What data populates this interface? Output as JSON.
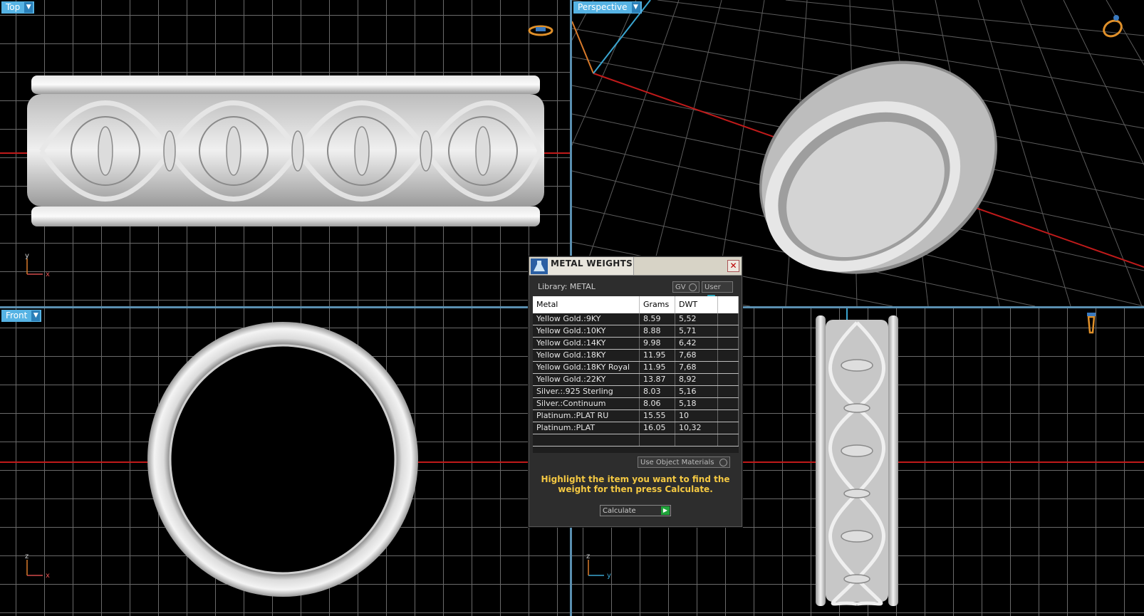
{
  "viewports": {
    "top": {
      "label": "Top",
      "axes": {
        "a": "y",
        "b": "x"
      }
    },
    "perspective": {
      "label": "Perspective"
    },
    "front": {
      "label": "Front",
      "axes": {
        "a": "z",
        "b": "x"
      }
    },
    "right": {
      "axes": {
        "a": "z",
        "b": "y"
      }
    }
  },
  "dialog": {
    "title": "METAL WEIGHTS",
    "close": "✕",
    "library": "Library: METAL",
    "gv_label": "GV",
    "user_label": "User",
    "columns": [
      "Metal",
      "Grams",
      "DWT"
    ],
    "rows": [
      {
        "metal": "Yellow Gold.:9KY",
        "grams": "8.59",
        "dwt": "5,52"
      },
      {
        "metal": "Yellow Gold.:10KY",
        "grams": "8.88",
        "dwt": "5,71"
      },
      {
        "metal": "Yellow Gold.:14KY",
        "grams": "9.98",
        "dwt": "6,42"
      },
      {
        "metal": "Yellow Gold.:18KY",
        "grams": "11.95",
        "dwt": "7,68"
      },
      {
        "metal": "Yellow Gold.:18KY Royal",
        "grams": "11.95",
        "dwt": "7,68"
      },
      {
        "metal": "Yellow Gold.:22KY",
        "grams": "13.87",
        "dwt": "8,92"
      },
      {
        "metal": "Silver.:.925 Sterling",
        "grams": "8.03",
        "dwt": "5,16"
      },
      {
        "metal": "Silver.:Continuum",
        "grams": "8.06",
        "dwt": "5,18"
      },
      {
        "metal": "Platinum.:PLAT RU",
        "grams": "15.55",
        "dwt": "10"
      },
      {
        "metal": "Platinum.:PLAT",
        "grams": "16.05",
        "dwt": "10,32"
      }
    ],
    "use_object_materials": "Use Object Materials",
    "hint": "Highlight the item you want to find the weight for then press Calculate.",
    "calculate": "Calculate"
  },
  "colors": {
    "accent": "#56b3e4",
    "axis_red": "#c01a1a",
    "hint_yellow": "#f4c842"
  }
}
